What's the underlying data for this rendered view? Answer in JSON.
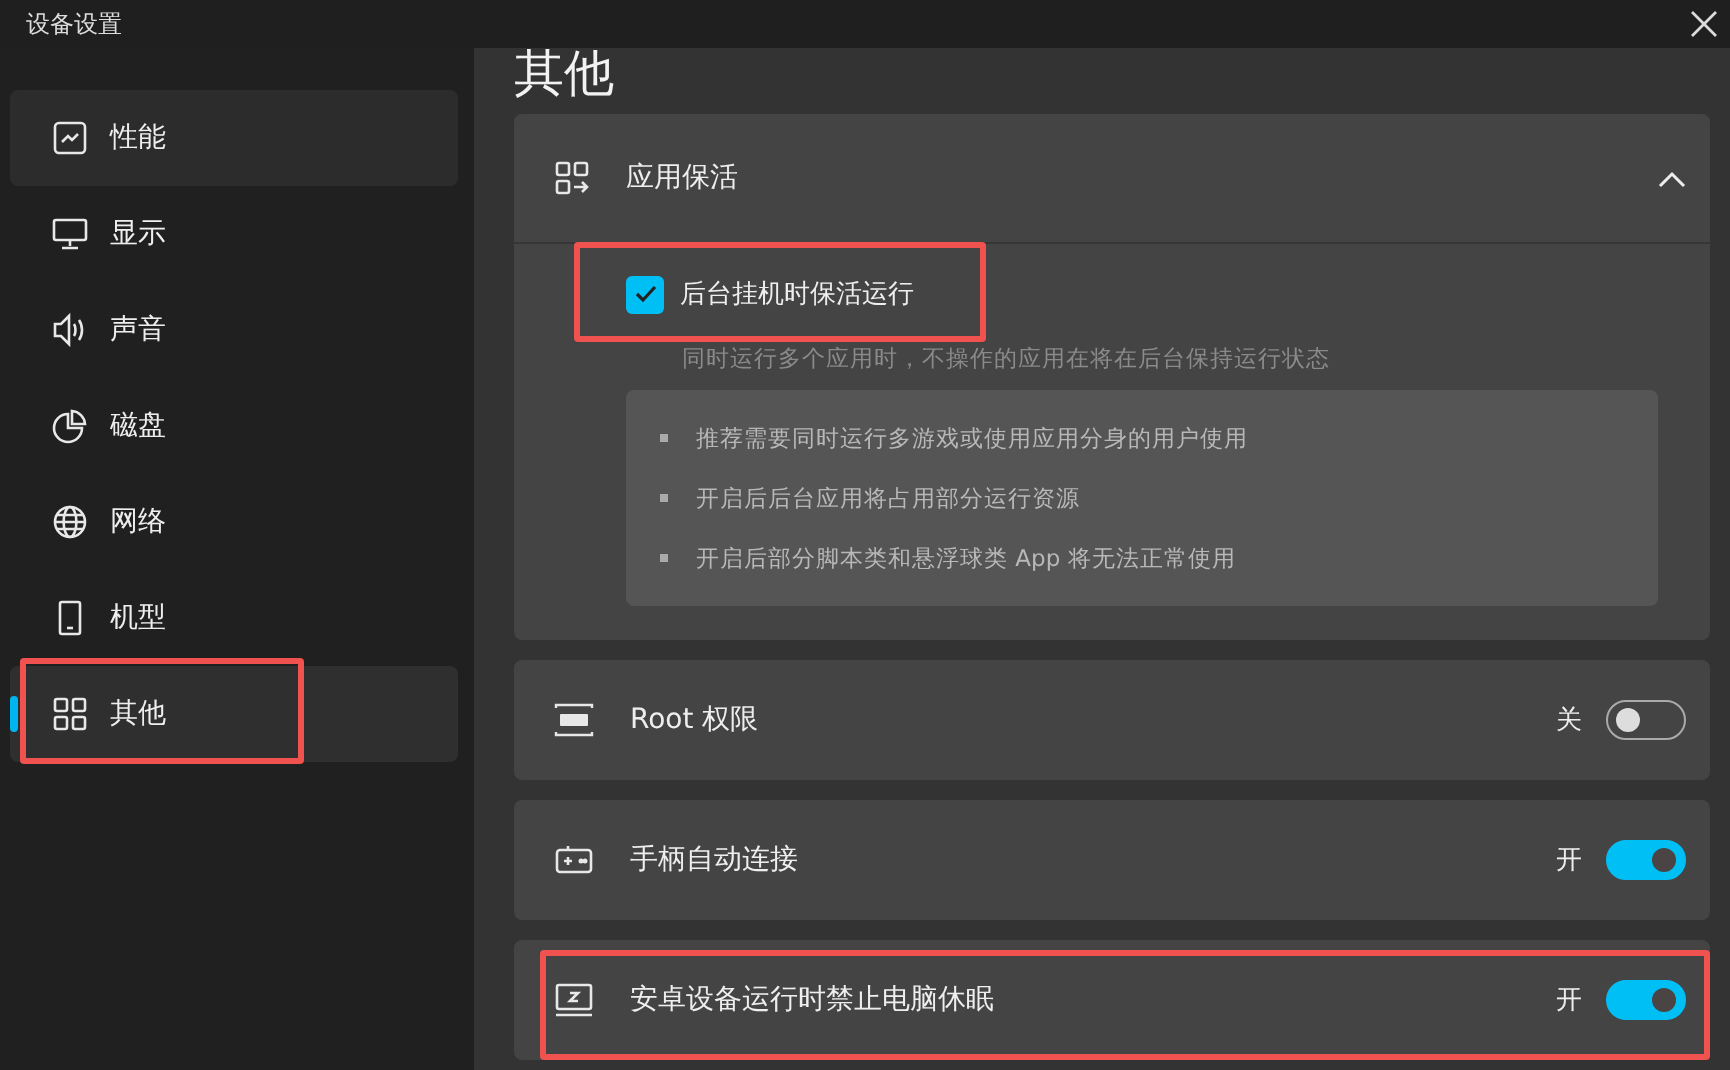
{
  "window": {
    "title": "设备设置"
  },
  "sidebar": {
    "items": [
      {
        "label": "性能",
        "selected": false,
        "hovered": true,
        "annotated": false
      },
      {
        "label": "显示",
        "selected": false,
        "hovered": false,
        "annotated": false
      },
      {
        "label": "声音",
        "selected": false,
        "hovered": false,
        "annotated": false
      },
      {
        "label": "磁盘",
        "selected": false,
        "hovered": false,
        "annotated": false
      },
      {
        "label": "网络",
        "selected": false,
        "hovered": false,
        "annotated": false
      },
      {
        "label": "机型",
        "selected": false,
        "hovered": false,
        "annotated": false
      },
      {
        "label": "其他",
        "selected": true,
        "hovered": false,
        "annotated": true
      }
    ]
  },
  "page_title": "其他",
  "sections": [
    {
      "kind": "expander",
      "title": "应用保活",
      "expanded": true,
      "option": {
        "label": "后台挂机时保活运行",
        "checked": true,
        "annotated": true,
        "description": "同时运行多个应用时，不操作的应用在将在后台保持运行状态"
      },
      "notes": [
        "推荐需要同时运行多游戏或使用应用分身的用户使用",
        "开启后后台应用将占用部分运行资源",
        "开启后部分脚本类和悬浮球类 App 将无法正常使用"
      ]
    },
    {
      "kind": "toggle",
      "title": "Root 权限",
      "state_label": "关",
      "on": false,
      "annotated": false
    },
    {
      "kind": "toggle",
      "title": "手柄自动连接",
      "state_label": "开",
      "on": true,
      "annotated": false
    },
    {
      "kind": "toggle",
      "title": "安卓设备运行时禁止电脑休眠",
      "state_label": "开",
      "on": true,
      "annotated": true
    }
  ]
}
